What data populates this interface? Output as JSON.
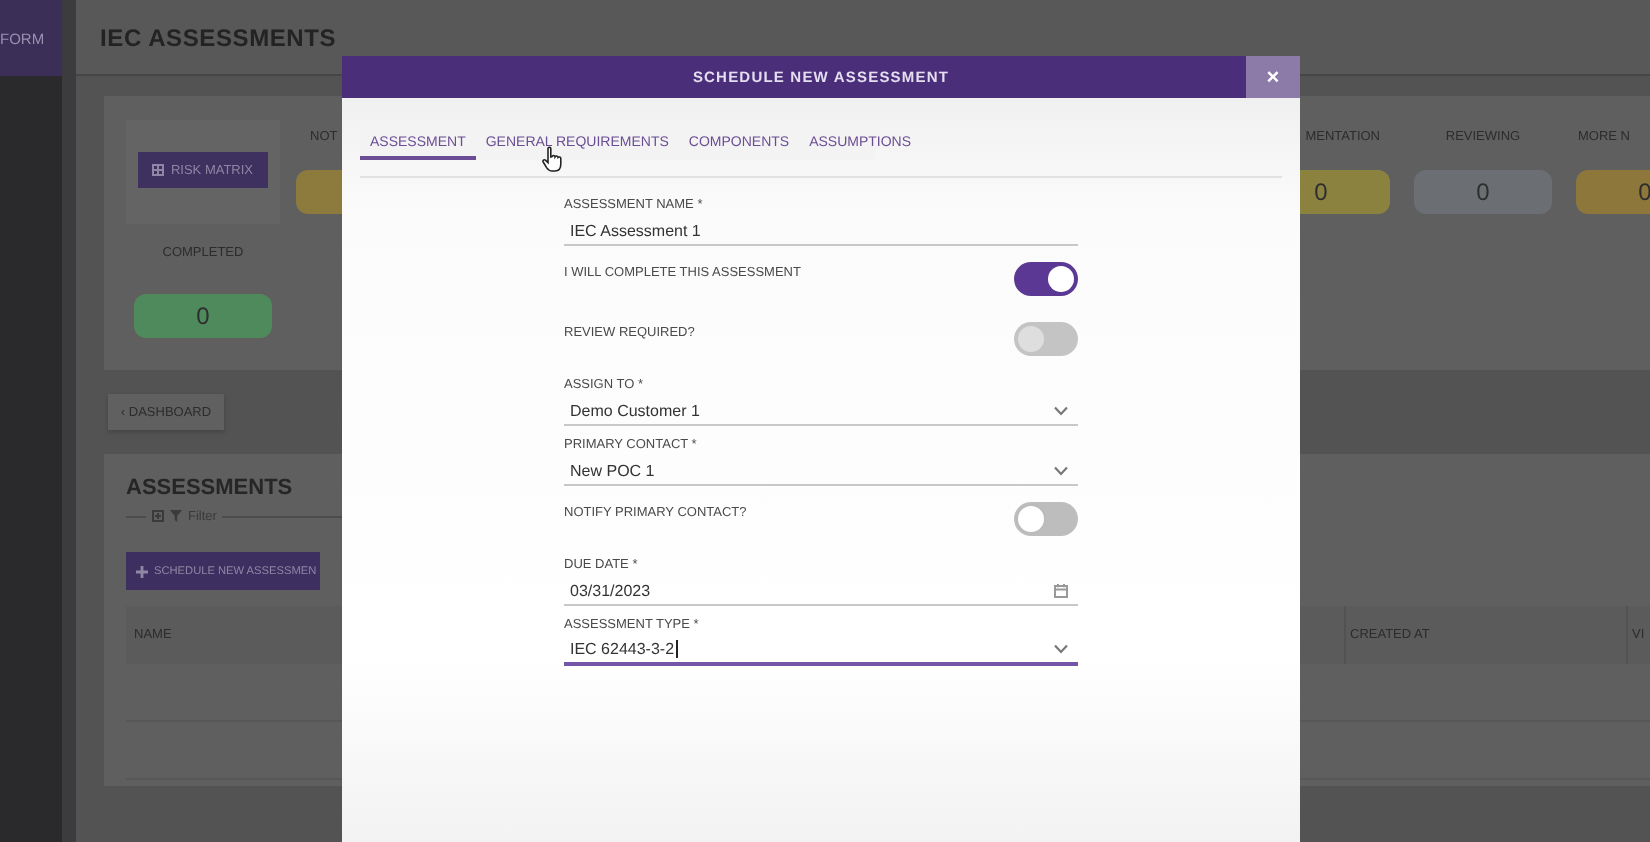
{
  "sidebar": {
    "brand": "FORM"
  },
  "header": {
    "title": "IEC ASSESSMENTS"
  },
  "summary": {
    "risk_matrix_button": "RISK MATRIX",
    "completed": {
      "label": "COMPLETED",
      "value": "0",
      "color": "#4f8a5d"
    },
    "status_columns": [
      {
        "label": "NOT",
        "color": "#8d7b3e"
      },
      {
        "label": "MENTATION",
        "value": "0",
        "color": "#8b823f"
      },
      {
        "label": "REVIEWING",
        "value": "0",
        "color": "#6b6f73"
      },
      {
        "label": "MORE N",
        "value": "0",
        "color": "#8d773a"
      }
    ]
  },
  "dashboard_button": "‹ DASHBOARD",
  "assessments": {
    "title": "ASSESSMENTS",
    "filter": "Filter",
    "schedule_button": "SCHEDULE NEW ASSESSMEN",
    "columns": [
      "NAME",
      "CREATED AT",
      "VI"
    ]
  },
  "modal": {
    "title": "SCHEDULE NEW ASSESSMENT",
    "close": "×",
    "tabs": [
      {
        "label": "ASSESSMENT",
        "selected": true
      },
      {
        "label": "GENERAL REQUIREMENTS",
        "selected": false
      },
      {
        "label": "COMPONENTS",
        "selected": false
      },
      {
        "label": "ASSUMPTIONS",
        "selected": false
      }
    ],
    "fields": [
      {
        "kind": "text",
        "label": "ASSESSMENT NAME *",
        "value": "IEC Assessment 1",
        "focused": false
      },
      {
        "kind": "toggle",
        "label": "I WILL COMPLETE THIS ASSESSMENT",
        "on": true,
        "disabled": false
      },
      {
        "kind": "toggle",
        "label": "REVIEW REQUIRED?",
        "on": false,
        "disabled": true
      },
      {
        "kind": "select",
        "label": "ASSIGN TO *",
        "value": "Demo Customer 1",
        "focused": false
      },
      {
        "kind": "select",
        "label": "PRIMARY CONTACT *",
        "value": "New POC 1",
        "focused": false
      },
      {
        "kind": "toggle",
        "label": "NOTIFY PRIMARY CONTACT?",
        "on": false,
        "disabled": false
      },
      {
        "kind": "date",
        "label": "DUE DATE *",
        "value": "03/31/2023",
        "focused": false
      },
      {
        "kind": "select",
        "label": "ASSESSMENT TYPE *",
        "value": "IEC 62443-3-2",
        "focused": true
      }
    ]
  }
}
